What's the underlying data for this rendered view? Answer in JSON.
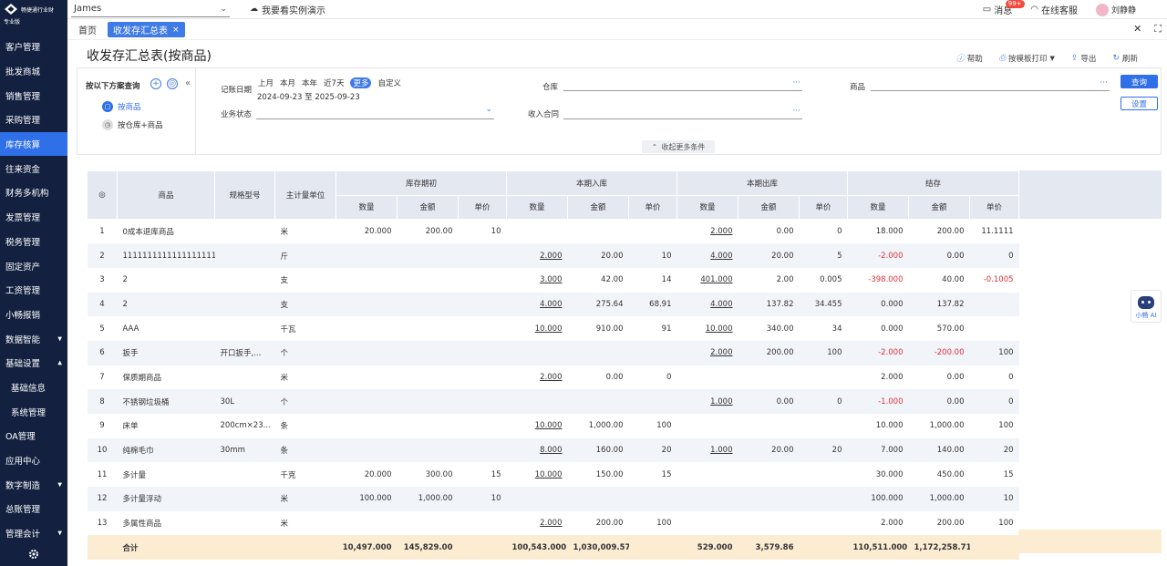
{
  "app": {
    "name": "畅捷通行业财",
    "edition": "专业版"
  },
  "sidebar": {
    "items": [
      {
        "label": "客户管理"
      },
      {
        "label": "批发商城"
      },
      {
        "label": "销售管理"
      },
      {
        "label": "采购管理"
      },
      {
        "label": "库存核算",
        "active": true
      },
      {
        "label": "往来资金"
      },
      {
        "label": "财务多机构"
      },
      {
        "label": "发票管理"
      },
      {
        "label": "税务管理"
      },
      {
        "label": "固定资产"
      },
      {
        "label": "工资管理"
      },
      {
        "label": "小畅报销"
      },
      {
        "label": "数据智能",
        "arrow": "▼"
      },
      {
        "label": "基础设置",
        "arrow": "▲"
      },
      {
        "label": "基础信息",
        "sub": true
      },
      {
        "label": "系统管理",
        "sub": true
      },
      {
        "label": "OA管理"
      },
      {
        "label": "应用中心"
      },
      {
        "label": "数字制造",
        "arrow": "▼"
      },
      {
        "label": "总账管理"
      },
      {
        "label": "管理会计",
        "arrow": "▼"
      }
    ]
  },
  "topbar": {
    "tenant": "James",
    "demo": "我要看实例演示",
    "messages": "消息",
    "message_badge": "99+",
    "support": "在线客服",
    "user": "刘静静"
  },
  "tabs": {
    "home": "首页",
    "active": "收发存汇总表"
  },
  "page": {
    "title": "收发存汇总表(按商品)"
  },
  "actions": {
    "help": "帮助",
    "print": "按模板打印",
    "export": "导出",
    "refresh": "刷新"
  },
  "filter": {
    "scheme_title": "按以下方案查询",
    "schemes": [
      "按商品",
      "按仓库+商品"
    ],
    "date_label": "记账日期",
    "quick": [
      "上月",
      "本月",
      "本年",
      "近7天",
      "更多",
      "自定义"
    ],
    "date_start": "2024-09-23",
    "date_sep": "至",
    "date_end": "2025-09-23",
    "status_label": "业务状态",
    "warehouse_label": "仓库",
    "contract_label": "收入合同",
    "product_label": "商品",
    "query_btn": "查询",
    "settings_btn": "设置",
    "collapse_label": "收起更多条件"
  },
  "table": {
    "headers": {
      "product": "商品",
      "spec": "规格型号",
      "unit": "主计量单位",
      "groups": [
        "库存期初",
        "本期入库",
        "本期出库",
        "结存"
      ],
      "qty": "数量",
      "amount": "金额",
      "price": "单价"
    },
    "rows": [
      {
        "no": "1",
        "name": "0成本退库商品",
        "spec": "",
        "unit": "米",
        "open_q": "20.000",
        "open_a": "200.00",
        "open_p": "10",
        "in_q": "",
        "in_a": "",
        "in_p": "",
        "out_q": "2.000",
        "out_a": "0.00",
        "out_p": "0",
        "end_q": "18.000",
        "end_a": "200.00",
        "end_p": "11.1111"
      },
      {
        "no": "2",
        "name": "1111111111111111111111...",
        "spec": "",
        "unit": "斤",
        "open_q": "",
        "open_a": "",
        "open_p": "",
        "in_q": "2.000",
        "in_a": "20.00",
        "in_p": "10",
        "out_q": "4.000",
        "out_a": "20.00",
        "out_p": "5",
        "end_q": "-2.000",
        "end_a": "0.00",
        "end_p": "0"
      },
      {
        "no": "3",
        "name": "2",
        "spec": "",
        "unit": "支",
        "open_q": "",
        "open_a": "",
        "open_p": "",
        "in_q": "3.000",
        "in_a": "42.00",
        "in_p": "14",
        "out_q": "401.000",
        "out_a": "2.00",
        "out_p": "0.005",
        "end_q": "-398.000",
        "end_a": "40.00",
        "end_p": "-0.1005"
      },
      {
        "no": "4",
        "name": "2",
        "spec": "",
        "unit": "支",
        "open_q": "",
        "open_a": "",
        "open_p": "",
        "in_q": "4.000",
        "in_a": "275.64",
        "in_p": "68.91",
        "out_q": "4.000",
        "out_a": "137.82",
        "out_p": "34.455",
        "end_q": "0.000",
        "end_a": "137.82",
        "end_p": ""
      },
      {
        "no": "5",
        "name": "AAA",
        "spec": "",
        "unit": "千瓦",
        "open_q": "",
        "open_a": "",
        "open_p": "",
        "in_q": "10.000",
        "in_a": "910.00",
        "in_p": "91",
        "out_q": "10.000",
        "out_a": "340.00",
        "out_p": "34",
        "end_q": "0.000",
        "end_a": "570.00",
        "end_p": ""
      },
      {
        "no": "6",
        "name": "扳手",
        "spec": "开口扳手,...",
        "unit": "个",
        "open_q": "",
        "open_a": "",
        "open_p": "",
        "in_q": "",
        "in_a": "",
        "in_p": "",
        "out_q": "2.000",
        "out_a": "200.00",
        "out_p": "100",
        "end_q": "-2.000",
        "end_a": "-200.00",
        "end_p": "100"
      },
      {
        "no": "7",
        "name": "保质期商品",
        "spec": "",
        "unit": "米",
        "open_q": "",
        "open_a": "",
        "open_p": "",
        "in_q": "2.000",
        "in_a": "0.00",
        "in_p": "0",
        "out_q": "",
        "out_a": "",
        "out_p": "",
        "end_q": "2.000",
        "end_a": "0.00",
        "end_p": "0"
      },
      {
        "no": "8",
        "name": "不锈钢垃圾桶",
        "spec": "30L",
        "unit": "个",
        "open_q": "",
        "open_a": "",
        "open_p": "",
        "in_q": "",
        "in_a": "",
        "in_p": "",
        "out_q": "1.000",
        "out_a": "0.00",
        "out_p": "0",
        "end_q": "-1.000",
        "end_a": "0.00",
        "end_p": "0"
      },
      {
        "no": "9",
        "name": "床单",
        "spec": "200cm×23...",
        "unit": "条",
        "open_q": "",
        "open_a": "",
        "open_p": "",
        "in_q": "10.000",
        "in_a": "1,000.00",
        "in_p": "100",
        "out_q": "",
        "out_a": "",
        "out_p": "",
        "end_q": "10.000",
        "end_a": "1,000.00",
        "end_p": "100"
      },
      {
        "no": "10",
        "name": "纯棉毛巾",
        "spec": "30mm",
        "unit": "条",
        "open_q": "",
        "open_a": "",
        "open_p": "",
        "in_q": "8.000",
        "in_a": "160.00",
        "in_p": "20",
        "out_q": "1.000",
        "out_a": "20.00",
        "out_p": "20",
        "end_q": "7.000",
        "end_a": "140.00",
        "end_p": "20"
      },
      {
        "no": "11",
        "name": "多计量",
        "spec": "",
        "unit": "千克",
        "open_q": "20.000",
        "open_a": "300.00",
        "open_p": "15",
        "in_q": "10.000",
        "in_a": "150.00",
        "in_p": "15",
        "out_q": "",
        "out_a": "",
        "out_p": "",
        "end_q": "30.000",
        "end_a": "450.00",
        "end_p": "15"
      },
      {
        "no": "12",
        "name": "多计量浮动",
        "spec": "",
        "unit": "米",
        "open_q": "100.000",
        "open_a": "1,000.00",
        "open_p": "10",
        "in_q": "",
        "in_a": "",
        "in_p": "",
        "out_q": "",
        "out_a": "",
        "out_p": "",
        "end_q": "100.000",
        "end_a": "1,000.00",
        "end_p": "10"
      },
      {
        "no": "13",
        "name": "多属性商品",
        "spec": "",
        "unit": "米",
        "open_q": "",
        "open_a": "",
        "open_p": "",
        "in_q": "2.000",
        "in_a": "200.00",
        "in_p": "100",
        "out_q": "",
        "out_a": "",
        "out_p": "",
        "end_q": "2.000",
        "end_a": "200.00",
        "end_p": "100"
      }
    ],
    "total": {
      "label": "合计",
      "open_q": "10,497.000",
      "open_a": "145,829.00",
      "in_q": "100,543.000",
      "in_a": "1,030,009.57",
      "out_q": "529.000",
      "out_a": "3,579.86",
      "end_q": "110,511.000",
      "end_a": "1,172,258.71"
    }
  },
  "ai": {
    "label": "小畅 AI"
  }
}
